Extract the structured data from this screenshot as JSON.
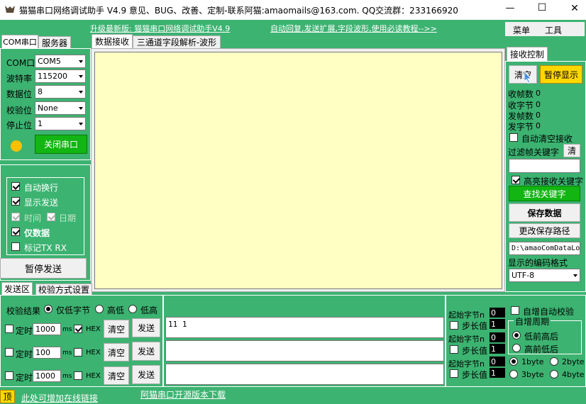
{
  "window": {
    "title": "猫猫串口网络调试助手 V4.9 意见、BUG、改善、定制-联系阿猫:amaomails@163.com. QQ交流群：233166920",
    "minimize": "—",
    "maximize": "☐",
    "close": "✕"
  },
  "banner": {
    "upgrade": "升级最新版: 猫猫串口网络调试助手V4.9",
    "auto_reply": "自动回复,发送扩展,字段波形,使用必读教程-->>",
    "menu": "菜单",
    "tools": "工具"
  },
  "left_tabs": {
    "com": "COM串口",
    "server": "服务器"
  },
  "main_tabs": {
    "recv": "数据接收",
    "wave": "三通道字段解析-波形"
  },
  "serial": {
    "com_label": "COM口",
    "com_value": "COM5",
    "baud_label": "波特率",
    "baud_value": "115200",
    "data_label": "数据位",
    "data_value": "8",
    "parity_label": "校验位",
    "parity_value": "None",
    "stop_label": "停止位",
    "stop_value": "1",
    "close_button": "关闭串口",
    "status_color": "#ffc000"
  },
  "display_options": {
    "auto_newline": "自动换行",
    "show_send": "显示发送",
    "time": "时间",
    "date": "日期",
    "data_only": "仅数据",
    "mark_txrx": "标记TX RX",
    "pause_send": "暂停发送"
  },
  "send_tabs": {
    "send": "发送区",
    "checksum": "校验方式设置"
  },
  "checksum": {
    "result_label": "校验结果",
    "low_byte": "仅低字节",
    "high_low": "高低",
    "low_high": "低高"
  },
  "send_rows": [
    {
      "timed": "定时",
      "interval": "1000",
      "ms": "ms",
      "hex": "HEX",
      "hex_checked": true,
      "clear": "清空",
      "send": "发送",
      "content": "11 1"
    },
    {
      "timed": "定时",
      "interval": "100",
      "ms": "ms",
      "hex": "HEX",
      "hex_checked": false,
      "clear": "清空",
      "send": "发送",
      "content": ""
    },
    {
      "timed": "定时",
      "interval": "1000",
      "ms": "ms",
      "hex": "HEX",
      "hex_checked": false,
      "clear": "清空",
      "send": "发送",
      "content": ""
    }
  ],
  "field_config": {
    "start_byte": "起始字节n",
    "step": "步长值",
    "rows": [
      {
        "start": "0",
        "step": "1"
      },
      {
        "start": "0",
        "step": "1"
      },
      {
        "start": "0",
        "step": "1"
      }
    ],
    "auto_checksum": "自增自动校验",
    "period_title": "自增周期",
    "low_first": "低前高后",
    "high_first": "高前低后",
    "b1": "1byte",
    "b2": "2byte",
    "b3": "3byte",
    "b4": "4byte"
  },
  "recv_control": {
    "tab": "接收控制",
    "clear": "清空",
    "pause": "暂停显示",
    "rx_frames": "收帧数",
    "rx_frames_v": "0",
    "rx_bytes": "收字节",
    "rx_bytes_v": "0",
    "tx_frames": "发帧数",
    "tx_frames_v": "0",
    "tx_bytes": "发字节",
    "tx_bytes_v": "0",
    "auto_clear": "自动清空接收",
    "filter_label": "过滤帧关键字",
    "filter_clear": "清",
    "highlight": "高亮接收关键字",
    "find_key": "查找关键字",
    "save_data": "保存数据",
    "change_path": "更改保存路径",
    "path_value": "D:\\amaoComDataLo",
    "encoding_label": "显示的编码格式",
    "encoding_value": "UTF-8"
  },
  "footer": {
    "pin": "顶",
    "add_link": "此处可增加在线链接",
    "download": "阿猫串口开源版本下载"
  }
}
